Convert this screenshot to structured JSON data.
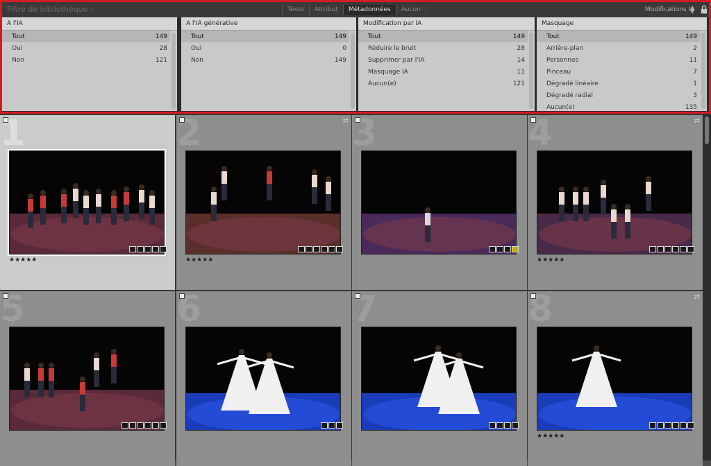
{
  "filter_bar": {
    "title": "Filtre de bibliothèque :",
    "tabs": [
      "Texte",
      "Attribut",
      "Métadonnées",
      "Aucun"
    ],
    "active_tab": "Métadonnées",
    "preset": "Modifications IA",
    "columns": [
      {
        "header": "A l'IA",
        "rows": [
          {
            "label": "Tout",
            "count": "149",
            "selected": true
          },
          {
            "label": "Oui",
            "count": "28"
          },
          {
            "label": "Non",
            "count": "121"
          }
        ]
      },
      {
        "header": "A l'IA générative",
        "rows": [
          {
            "label": "Tout",
            "count": "149",
            "selected": true
          },
          {
            "label": "Oui",
            "count": "0"
          },
          {
            "label": "Non",
            "count": "149"
          }
        ]
      },
      {
        "header": "Modification par IA",
        "rows": [
          {
            "label": "Tout",
            "count": "149",
            "selected": true
          },
          {
            "label": "Réduire le bruit",
            "count": "28"
          },
          {
            "label": "Supprimer par l'IA",
            "count": "14"
          },
          {
            "label": "Masquage IA",
            "count": "11"
          },
          {
            "label": "Aucun(e)",
            "count": "121"
          }
        ]
      },
      {
        "header": "Masquage",
        "rows": [
          {
            "label": "Tout",
            "count": "149",
            "selected": true
          },
          {
            "label": "Arrière-plan",
            "count": "2"
          },
          {
            "label": "Personnes",
            "count": "11"
          },
          {
            "label": "Pinceau",
            "count": "7"
          },
          {
            "label": "Dégradé linéaire",
            "count": "1"
          },
          {
            "label": "Dégradé radial",
            "count": "3"
          },
          {
            "label": "Aucun(e)",
            "count": "135"
          }
        ]
      }
    ]
  },
  "grid": {
    "cells": [
      {
        "index": "1",
        "stars": "★★★★★",
        "selected": true,
        "sync": true,
        "badges": 5,
        "yellow_badge": false,
        "floor": "#5a2a3a"
      },
      {
        "index": "2",
        "stars": "★★★★★",
        "selected": false,
        "sync": true,
        "badges": 6,
        "yellow_badge": false,
        "floor": "#5a2f2a"
      },
      {
        "index": "3",
        "stars": "",
        "selected": false,
        "sync": false,
        "badges": 4,
        "yellow_badge": true,
        "floor": "#4a2a5a"
      },
      {
        "index": "4",
        "stars": "★★★★★",
        "selected": false,
        "sync": true,
        "badges": 6,
        "yellow_badge": false,
        "floor": "#4a2a4a"
      },
      {
        "index": "5",
        "stars": "",
        "selected": false,
        "sync": false,
        "badges": 6,
        "yellow_badge": false,
        "floor": "#5a2a3a"
      },
      {
        "index": "6",
        "stars": "",
        "selected": false,
        "sync": false,
        "badges": 3,
        "yellow_badge": false,
        "floor": "#1b3cb8"
      },
      {
        "index": "7",
        "stars": "",
        "selected": false,
        "sync": false,
        "badges": 4,
        "yellow_badge": false,
        "floor": "#1b3cb8"
      },
      {
        "index": "8",
        "stars": "★★★★★",
        "selected": false,
        "sync": true,
        "badges": 6,
        "yellow_badge": false,
        "floor": "#1b3cb8"
      }
    ]
  }
}
